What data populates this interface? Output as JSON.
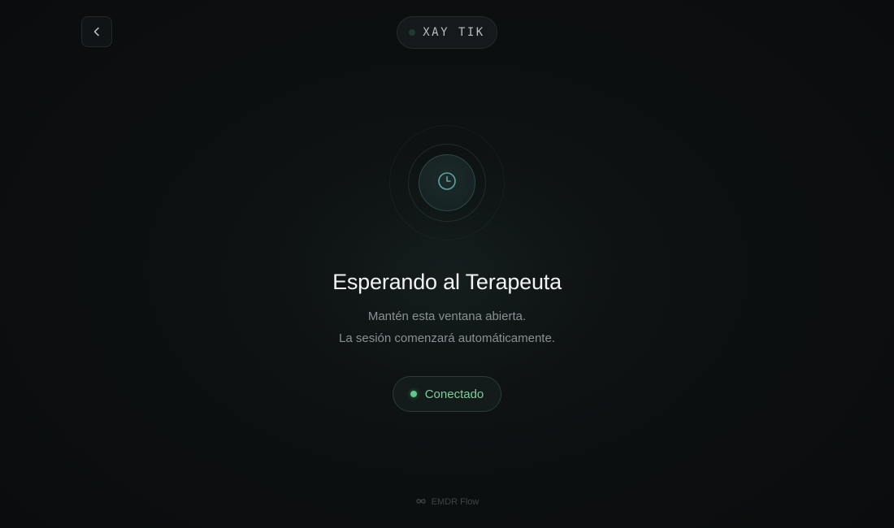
{
  "header": {
    "back_icon": "chevron-left-icon",
    "session_code": "XAY TIK",
    "session_status_color": "#1f3a30"
  },
  "main": {
    "icon": "clock-icon",
    "title": "Esperando al Terapeuta",
    "subtitle_line1": "Mantén esta ventana abierta.",
    "subtitle_line2": "La sesión comenzará automáticamente.",
    "status": {
      "label": "Conectado",
      "color": "#5fc98a"
    }
  },
  "footer": {
    "icon": "infinity-icon",
    "brand": "EMDR Flow"
  },
  "colors": {
    "background": "#0b0d0e",
    "accent": "#5fc98a",
    "clock_accent": "#5aa6a0"
  }
}
